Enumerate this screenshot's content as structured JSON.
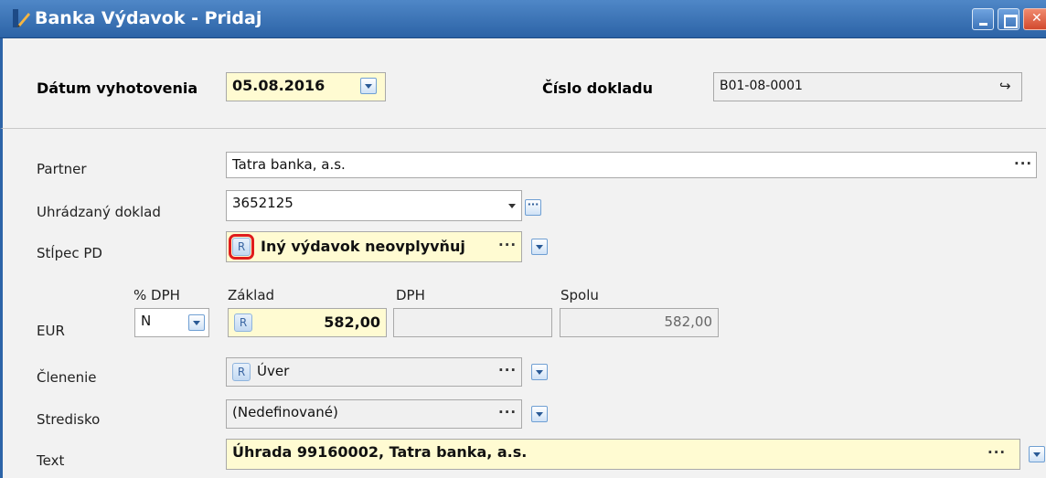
{
  "window": {
    "title": "Banka Výdavok - Pridaj"
  },
  "header": {
    "date_label": "Dátum vyhotovenia",
    "date_value": "05.08.2016",
    "doc_label": "Číslo dokladu",
    "doc_value": "B01-08-0001"
  },
  "form": {
    "partner": {
      "label": "Partner",
      "value": "Tatra banka, a.s."
    },
    "paid_doc": {
      "label": "Uhrádzaný doklad",
      "value": "3652125"
    },
    "pd_column": {
      "label": "Stĺpec PD",
      "r": "R",
      "value": "Iný výdavok neovplyvňuj"
    },
    "amounts": {
      "currency": "EUR",
      "vat_pct_label": "% DPH",
      "vat_pct_value": "N",
      "base_label": "Základ",
      "base_r": "R",
      "base_value": "582,00",
      "vat_label": "DPH",
      "vat_value": "",
      "total_label": "Spolu",
      "total_value": "582,00"
    },
    "division": {
      "label": "Členenie",
      "r": "R",
      "value": "Úver"
    },
    "center": {
      "label": "Stredisko",
      "value": "(Nedefinované)"
    },
    "text": {
      "label": "Text",
      "value": "Úhrada 99160002, Tatra banka, a.s."
    }
  },
  "icons": [
    "pencil-icon",
    "minimize-icon",
    "maximize-icon",
    "close-icon",
    "refresh-icon",
    "dropdown-arrow-icon",
    "ellipsis-icon"
  ],
  "colors": {
    "titlebar": "#2c63a6",
    "required_field": "#fffbd2",
    "highlight": "#e01d1d"
  }
}
